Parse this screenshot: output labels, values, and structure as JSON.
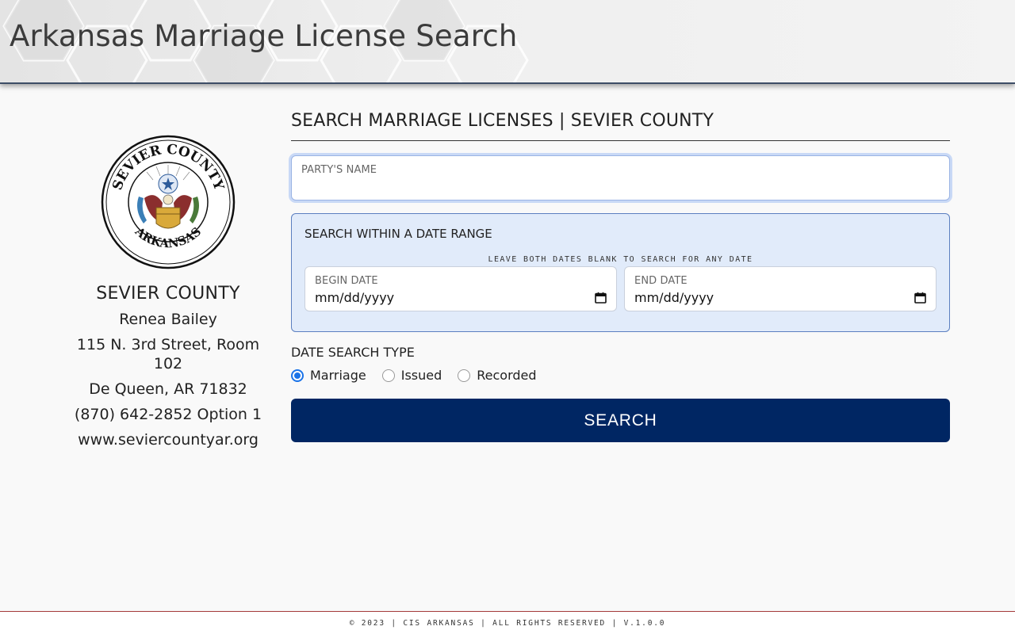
{
  "header": {
    "title": "Arkansas Marriage License Search"
  },
  "sidebar": {
    "seal_icon": "county-seal-icon",
    "seal_top_text": "SEVIER COUNTY",
    "seal_bottom_text": "ARKANSAS",
    "county_name": "SEVIER COUNTY",
    "clerk_name": "Renea Bailey",
    "address_line1": "115 N. 3rd Street, Room",
    "address_line2": "102",
    "city_state_zip": "De Queen, AR 71832",
    "phone": "(870) 642-2852 Option 1",
    "website": "www.seviercountyar.org"
  },
  "main": {
    "title": "SEARCH MARRIAGE LICENSES | SEVIER COUNTY",
    "party_name": {
      "label": "PARTY'S NAME",
      "value": ""
    },
    "date_range": {
      "title": "SEARCH WITHIN A DATE RANGE",
      "hint": "LEAVE BOTH DATES BLANK TO SEARCH FOR ANY DATE",
      "begin": {
        "label": "BEGIN DATE",
        "value": "mm/dd/yyyy",
        "icon": "calendar-icon"
      },
      "end": {
        "label": "END DATE",
        "value": "mm/dd/yyyy",
        "icon": "calendar-icon"
      }
    },
    "date_search_type": {
      "label": "DATE SEARCH TYPE",
      "options": [
        "Marriage",
        "Issued",
        "Recorded"
      ],
      "selected": "Marriage"
    },
    "search_button": "SEARCH"
  },
  "footer": {
    "text": "© 2023 | CIS ARKANSAS | ALL RIGHTS RESERVED | V.1.0.0"
  },
  "colors": {
    "primary_button": "#002663",
    "range_background": "#e1ebfa",
    "range_border": "#5b7fc0",
    "radio_selected": "#1a73e8",
    "footer_border": "#a33a3a",
    "header_border": "#3d4d66"
  }
}
